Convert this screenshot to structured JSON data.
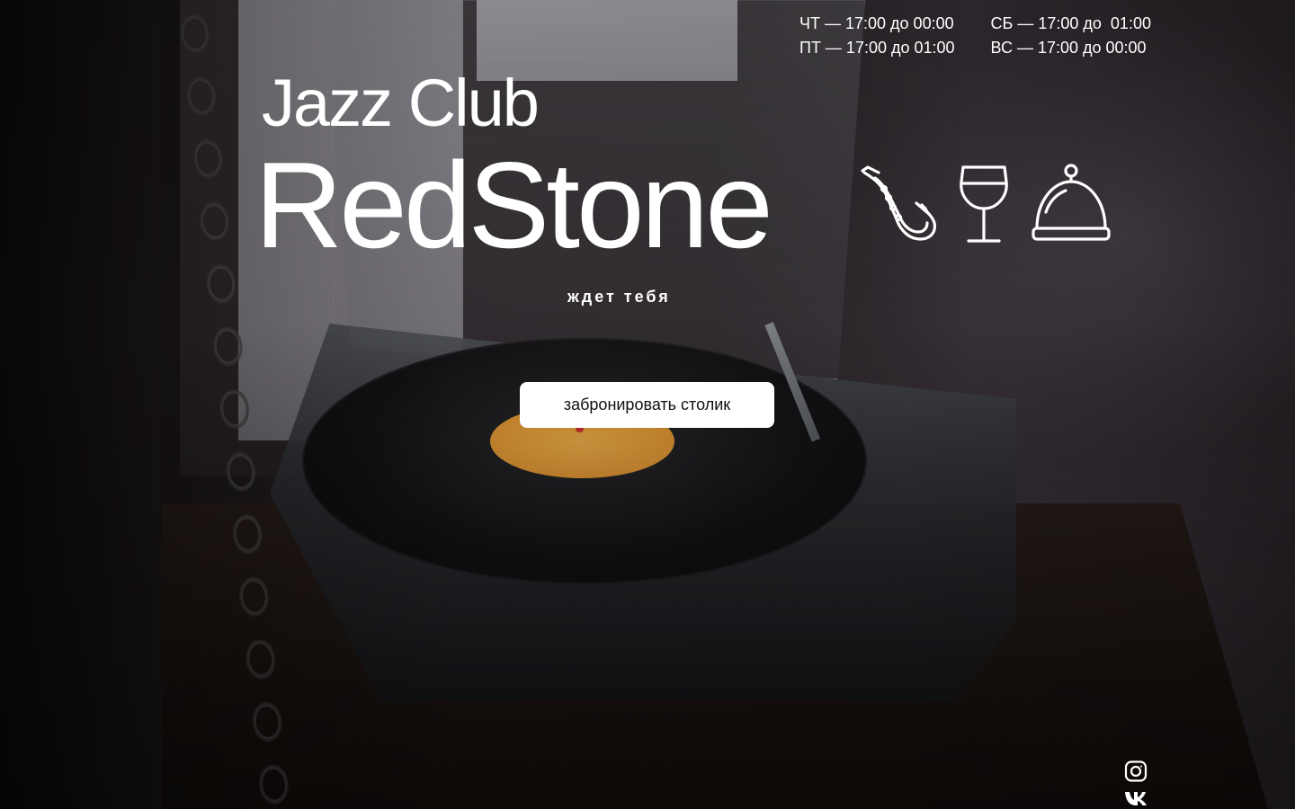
{
  "hours": {
    "col1": [
      "ЧТ — 17:00 до 00:00",
      "ПТ — 17:00 до 01:00"
    ],
    "col2": [
      "СБ — 17:00 до  01:00",
      "ВС — 17:00 до 00:00"
    ]
  },
  "hero": {
    "title_small": "Jazz Club",
    "title_big": "RedStone",
    "tagline": "ждет тебя",
    "book_button": "забронировать столик"
  },
  "icons": [
    "saxophone-icon",
    "wine-glass-icon",
    "cloche-icon"
  ],
  "social": [
    "instagram-icon",
    "vk-icon"
  ],
  "colors": {
    "text": "#ffffff",
    "button_bg": "#ffffff",
    "button_text": "#111111"
  }
}
